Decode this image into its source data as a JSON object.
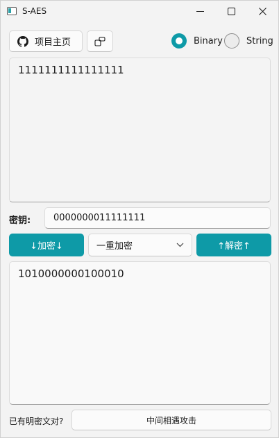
{
  "window": {
    "title": "S-AES"
  },
  "toolbar": {
    "home_label": "项目主页",
    "mode_options": [
      {
        "label": "Binary",
        "selected": true
      },
      {
        "label": "String",
        "selected": false
      }
    ]
  },
  "input": {
    "value": "1111111111111111"
  },
  "key": {
    "label": "密钥:",
    "value": "0000000011111111"
  },
  "actions": {
    "encrypt_label": "↓加密↓",
    "mode_selected": "一重加密",
    "decrypt_label": "↑解密↑"
  },
  "output": {
    "value": "1010000000100010"
  },
  "footer": {
    "question_label": "已有明密文对?",
    "attack_label": "中间相遇攻击"
  },
  "colors": {
    "accent": "#0e9aa7",
    "background": "#f3f3f3"
  },
  "icons": {
    "app": "app-window-icon",
    "home": "github-icon",
    "switch": "switch-window-icon",
    "select": "chevron-down-icon"
  }
}
